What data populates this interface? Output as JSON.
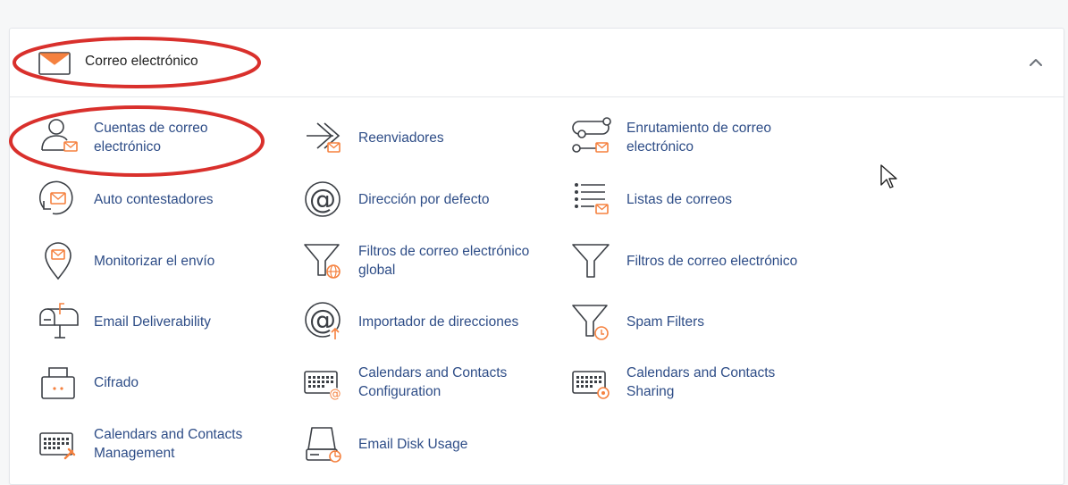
{
  "section": {
    "title": "Correo electrónico",
    "icon": "envelope-icon",
    "collapse_icon": "chevron-up-icon"
  },
  "colors": {
    "accent": "#f5813f",
    "link": "#2e4d87",
    "icon_stroke": "#3b3f45",
    "annotation": "#d9302c"
  },
  "items": [
    {
      "label": "Cuentas de correo\nelectrónico",
      "icon": "email-accounts-icon"
    },
    {
      "label": "Reenviadores",
      "icon": "forwarders-icon"
    },
    {
      "label": "Enrutamiento de correo\nelectrónico",
      "icon": "email-routing-icon"
    },
    {
      "label": "Auto contestadores",
      "icon": "autoresponders-icon"
    },
    {
      "label": "Dirección por defecto",
      "icon": "default-address-icon"
    },
    {
      "label": "Listas de correos",
      "icon": "mailing-lists-icon"
    },
    {
      "label": "Monitorizar el envío",
      "icon": "track-delivery-icon"
    },
    {
      "label": "Filtros de correo electrónico\nglobal",
      "icon": "global-email-filters-icon"
    },
    {
      "label": "Filtros de correo electrónico",
      "icon": "email-filters-icon"
    },
    {
      "label": "Email Deliverability",
      "icon": "mailbox-icon"
    },
    {
      "label": "Importador de direcciones",
      "icon": "address-importer-icon"
    },
    {
      "label": "Spam Filters",
      "icon": "spam-filters-icon"
    },
    {
      "label": "Cifrado",
      "icon": "encryption-icon"
    },
    {
      "label": "Calendars and Contacts\nConfiguration",
      "icon": "calendar-config-icon"
    },
    {
      "label": "Calendars and Contacts\nSharing",
      "icon": "calendar-sharing-icon"
    },
    {
      "label": "Calendars and Contacts\nManagement",
      "icon": "calendar-management-icon"
    },
    {
      "label": "Email Disk Usage",
      "icon": "disk-usage-icon"
    }
  ]
}
